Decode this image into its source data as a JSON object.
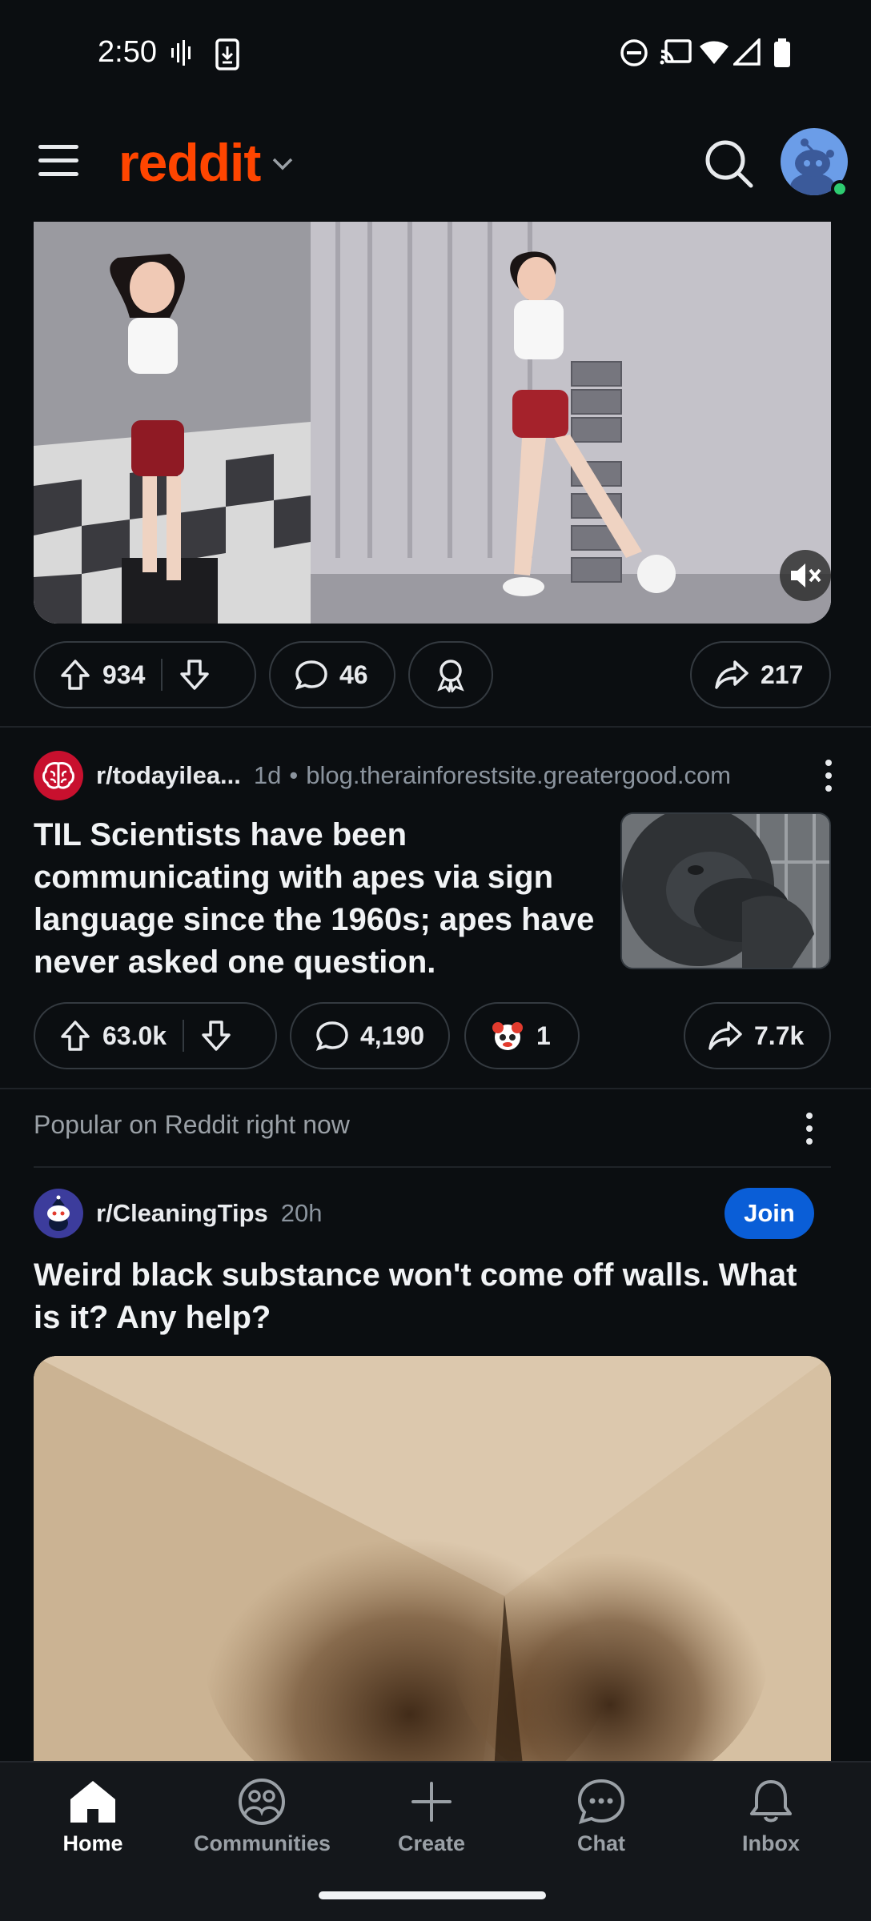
{
  "status_bar": {
    "time": "2:50"
  },
  "header": {
    "brand": "reddit"
  },
  "video_post": {
    "upvotes": "934",
    "comments": "46",
    "shares": "217"
  },
  "til_post": {
    "subreddit": "r/todayilea...",
    "age": "1d",
    "bullet": "•",
    "domain": "blog.therainforestsite.greatergood.com",
    "title": "TIL Scientists have been communicating with apes via sign language since the 1960s; apes have never asked one question.",
    "upvotes": "63.0k",
    "comments": "4,190",
    "awards": "1",
    "shares": "7.7k"
  },
  "popular_section": {
    "label": "Popular on Reddit right now"
  },
  "cleaning_post": {
    "subreddit": "r/CleaningTips",
    "age": "20h",
    "join_label": "Join",
    "title": "Weird black substance won't come off walls. What is it? Any help?"
  },
  "bottom_nav": {
    "items": [
      {
        "label": "Home",
        "icon": "home-icon",
        "active": true
      },
      {
        "label": "Communities",
        "icon": "communities-icon"
      },
      {
        "label": "Create",
        "icon": "plus-icon"
      },
      {
        "label": "Chat",
        "icon": "chat-icon"
      },
      {
        "label": "Inbox",
        "icon": "bell-icon"
      }
    ]
  },
  "colors": {
    "brand": "#ff4500",
    "join": "#0a5ed7",
    "background": "#0b0e11"
  }
}
